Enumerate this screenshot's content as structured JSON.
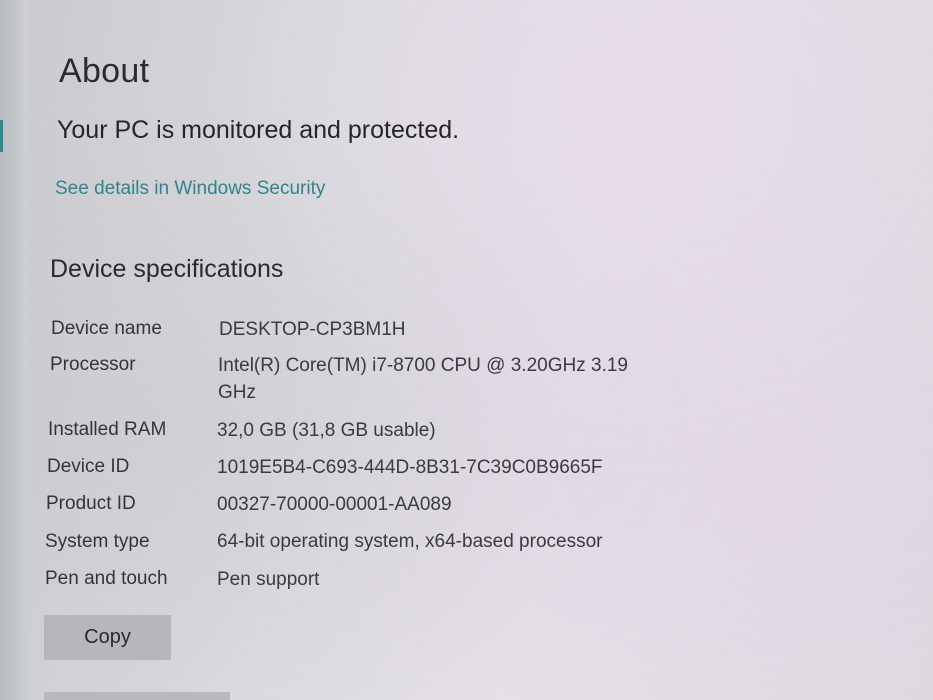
{
  "page": {
    "title": "About"
  },
  "protection": {
    "status_text": "Your PC is monitored and protected.",
    "link_text": "See details in Windows Security"
  },
  "device_specs": {
    "heading": "Device specifications",
    "rows": [
      {
        "label": "Device name",
        "value": "DESKTOP-CP3BM1H"
      },
      {
        "label": "Processor",
        "value": "Intel(R) Core(TM) i7-8700 CPU @ 3.20GHz   3.19 GHz"
      },
      {
        "label": "Installed RAM",
        "value": "32,0 GB (31,8 GB usable)"
      },
      {
        "label": "Device ID",
        "value": "1019E5B4-C693-444D-8B31-7C39C0B9665F"
      },
      {
        "label": "Product ID",
        "value": "00327-70000-00001-AA089"
      },
      {
        "label": "System type",
        "value": "64-bit operating system, x64-based processor"
      },
      {
        "label": "Pen and touch",
        "value": "Pen support"
      }
    ],
    "copy_label": "Copy"
  },
  "colors": {
    "link": "#2f8490",
    "button_bg": "#b7b6ba",
    "accent": "#2c8a8a"
  }
}
